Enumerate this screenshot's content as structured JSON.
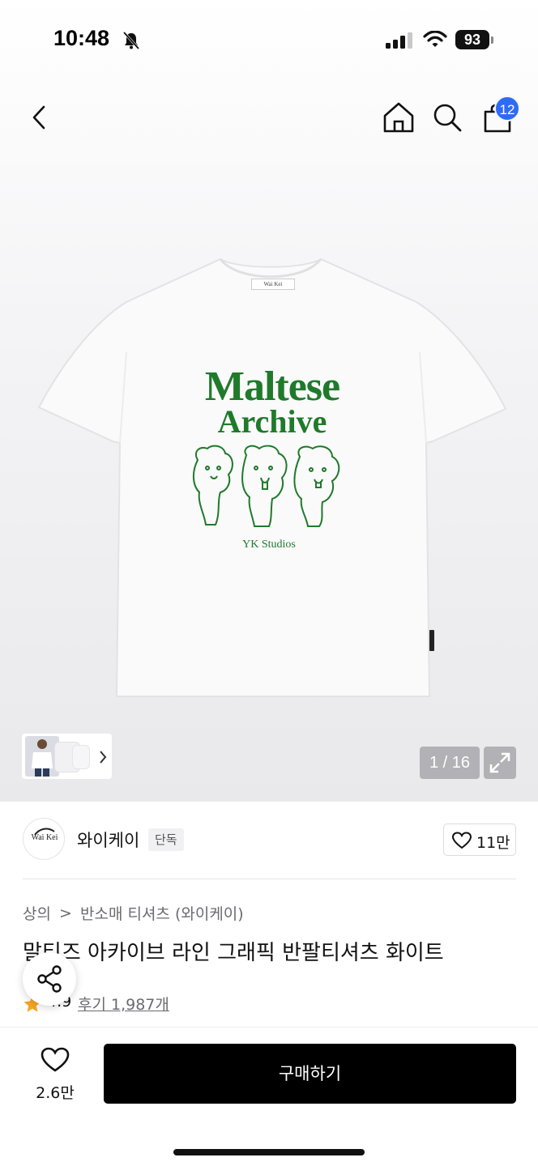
{
  "status_bar": {
    "time": "10:48",
    "battery": "93",
    "icons": [
      "bell-slash-icon",
      "signal-icon",
      "wifi-icon",
      "battery-icon"
    ]
  },
  "nav": {
    "icons": [
      "back-icon",
      "home-icon",
      "search-icon",
      "cart-icon"
    ],
    "cart_badge": "12"
  },
  "product_image": {
    "print_line1": "Maltese",
    "print_line2": "Archive",
    "print_studio": "YK Studios",
    "neck_label": "Wai Kei",
    "counter": "1 / 16"
  },
  "brand": {
    "name": "와이케이",
    "badge": "단독",
    "logo_text": "Wai Kei",
    "likes": "11만"
  },
  "breadcrumb": {
    "category": "상의",
    "separator": ">",
    "subcategory": "반소매 티셔츠 (와이케이)"
  },
  "product": {
    "title": "말티즈 아카이브 라인 그래픽 반팔티셔츠 화이트",
    "rating": "4.9",
    "reviews": "후기 1,987개"
  },
  "bottom_bar": {
    "wish_count": "2.6만",
    "buy_label": "구매하기"
  },
  "colors": {
    "accent_badge": "#2e6bf5",
    "print_green": "#1f7a2b",
    "buy_button": "#000000",
    "star": "#f5a623"
  }
}
